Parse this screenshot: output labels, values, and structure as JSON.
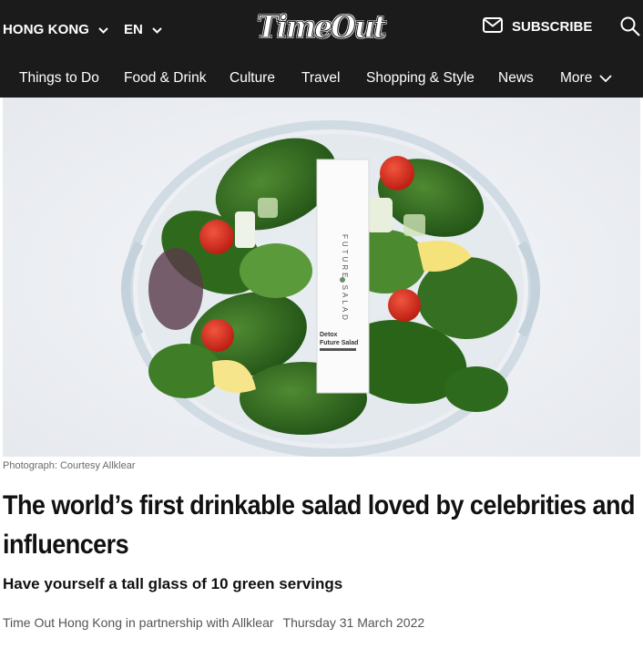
{
  "header": {
    "edition": "HONG KONG",
    "language": "EN",
    "logo": "TimeOut",
    "subscribe_label": "SUBSCRIBE"
  },
  "nav": {
    "items": [
      "Things to Do",
      "Food & Drink",
      "Culture",
      "Travel",
      "Shopping & Style",
      "News"
    ],
    "more_label": "More"
  },
  "hero": {
    "product_brand": "FUTURE SALAD",
    "product_name_line1": "Detox",
    "product_name_line2": "Future Salad"
  },
  "article": {
    "photo_credit": "Photograph: Courtesy Allklear",
    "headline": "The world’s first drinkable salad loved by celebrities and influencers",
    "subheadline": "Have yourself a tall glass of 10 green servings",
    "author": "Time Out Hong Kong in partnership with Allklear",
    "date": "Thursday 31 March 2022"
  },
  "icons": {
    "edition_chevron": "chevron-down-icon",
    "language_chevron": "chevron-down-icon",
    "subscribe": "envelope-icon",
    "search": "search-icon",
    "more_chevron": "chevron-down-icon"
  },
  "colors": {
    "header_bg": "#1b1b1b",
    "header_text": "#ffffff",
    "body_text": "#111111",
    "meta_text": "#555555"
  }
}
